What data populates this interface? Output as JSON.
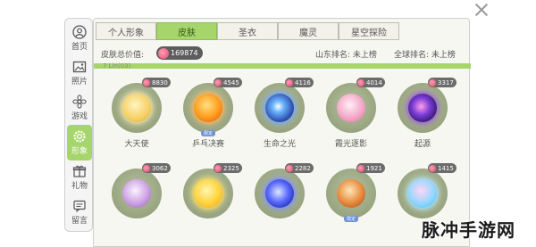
{
  "sidebar": {
    "items": [
      {
        "label": "首页",
        "icon": "user-circle-icon"
      },
      {
        "label": "照片",
        "icon": "photo-icon"
      },
      {
        "label": "游戏",
        "icon": "flower-icon"
      },
      {
        "label": "形象",
        "icon": "gear-icon",
        "active": true
      },
      {
        "label": "礼物",
        "icon": "gift-icon"
      },
      {
        "label": "留言",
        "icon": "message-icon"
      }
    ]
  },
  "tabs": [
    {
      "label": "个人形象"
    },
    {
      "label": "皮肤",
      "active": true
    },
    {
      "label": "圣衣"
    },
    {
      "label": "魔灵"
    },
    {
      "label": "星空探险"
    }
  ],
  "stats": {
    "total_label": "皮肤总价值:",
    "total_value": "169874",
    "rank_mountain": "山东排名: 未上榜",
    "rank_global": "全球排名: 未上榜",
    "count_text": "7 Lin(03)"
  },
  "skins": [
    {
      "name": "大天使",
      "value": "8830",
      "orb": "o1"
    },
    {
      "name": "乒乓决赛",
      "value": "4545",
      "orb": "o2",
      "tag": "限定"
    },
    {
      "name": "生命之光",
      "value": "4116",
      "orb": "o3"
    },
    {
      "name": "霞光逐影",
      "value": "4014",
      "orb": "o4"
    },
    {
      "name": "起源",
      "value": "3317",
      "orb": "o5"
    },
    {
      "name": "",
      "value": "3062",
      "orb": "o6"
    },
    {
      "name": "",
      "value": "2325",
      "orb": "o7"
    },
    {
      "name": "",
      "value": "2282",
      "orb": "o8"
    },
    {
      "name": "",
      "value": "1921",
      "orb": "o9",
      "tag": "限定"
    },
    {
      "name": "",
      "value": "1415",
      "orb": "o10"
    }
  ],
  "watermark": "脉冲手游网",
  "colors": {
    "accent": "#a6d66b",
    "panel": "#f7f7f2",
    "pill": "#5d5d5d",
    "gem": "#e14b6c"
  }
}
